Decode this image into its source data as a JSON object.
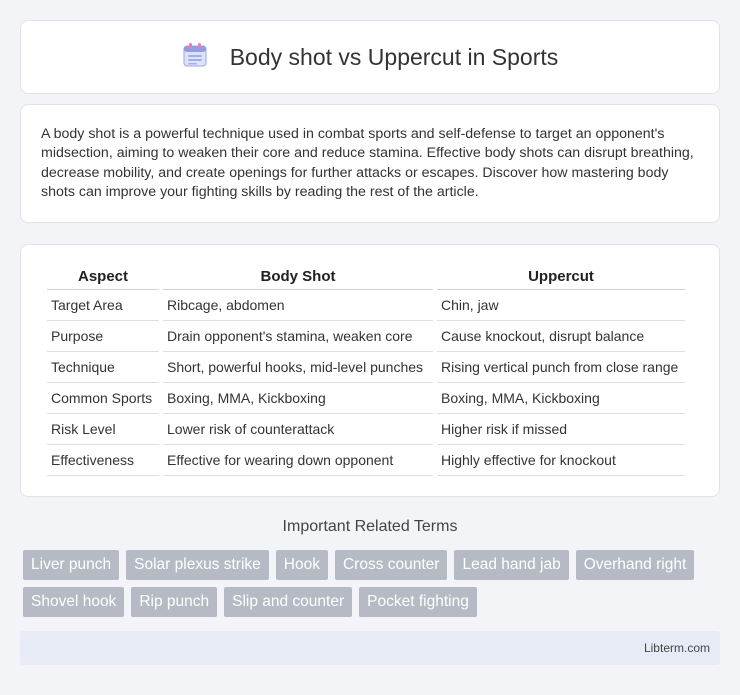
{
  "header": {
    "title": "Body shot vs Uppercut in Sports",
    "icon": "calendar-icon"
  },
  "intro": {
    "text": "A body shot is a powerful technique used in combat sports and self-defense to target an opponent's midsection, aiming to weaken their core and reduce stamina. Effective body shots can disrupt breathing, decrease mobility, and create openings for further attacks or escapes. Discover how mastering body shots can improve your fighting skills by reading the rest of the article."
  },
  "table": {
    "headers": [
      "Aspect",
      "Body Shot",
      "Uppercut"
    ],
    "rows": [
      [
        "Target Area",
        "Ribcage, abdomen",
        "Chin, jaw"
      ],
      [
        "Purpose",
        "Drain opponent's stamina, weaken core",
        "Cause knockout, disrupt balance"
      ],
      [
        "Technique",
        "Short, powerful hooks, mid-level punches",
        "Rising vertical punch from close range"
      ],
      [
        "Common Sports",
        "Boxing, MMA, Kickboxing",
        "Boxing, MMA, Kickboxing"
      ],
      [
        "Risk Level",
        "Lower risk of counterattack",
        "Higher risk if missed"
      ],
      [
        "Effectiveness",
        "Effective for wearing down opponent",
        "Highly effective for knockout"
      ]
    ]
  },
  "related": {
    "title": "Important Related Terms",
    "tags": [
      "Liver punch",
      "Solar plexus strike",
      "Hook",
      "Cross counter",
      "Lead hand jab",
      "Overhand right",
      "Shovel hook",
      "Rip punch",
      "Slip and counter",
      "Pocket fighting"
    ]
  },
  "footer": {
    "text": "Libterm.com"
  }
}
